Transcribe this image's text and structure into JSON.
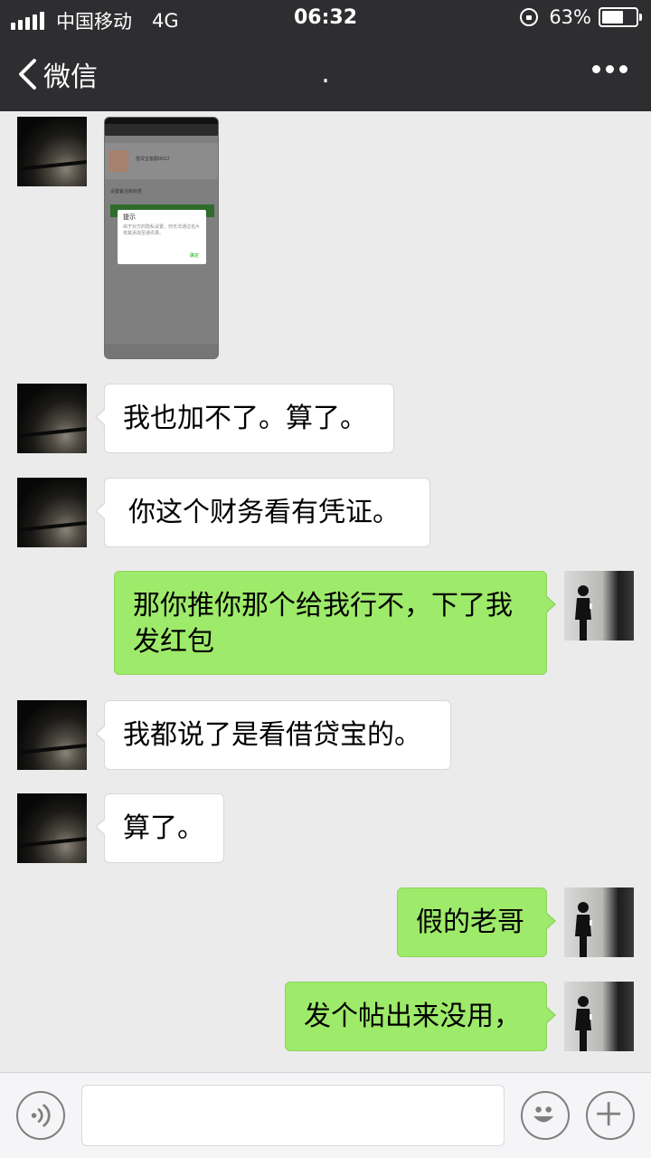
{
  "status_bar": {
    "carrier": "中国移动",
    "network": "4G",
    "time": "06:32",
    "battery": "63%",
    "battery_level": 0.63
  },
  "nav": {
    "back_label": "微信",
    "title": "."
  },
  "image_message": {
    "dialog_title": "提示",
    "dialog_body": "由于对方的隐私设置，你无法通过名片将其添加至通讯录。",
    "dialog_button": "确定",
    "profile_name": "借贷宝客服0022",
    "setting_label": "设置备注和标签"
  },
  "messages": [
    {
      "side": "in",
      "text": "我也加不了。算了。"
    },
    {
      "side": "in",
      "text": "你这个财务看有凭证。"
    },
    {
      "side": "out",
      "text": "那你推你那个给我行不，下了我发红包"
    },
    {
      "side": "in",
      "text": "我都说了是看借贷宝的。"
    },
    {
      "side": "in",
      "text": "算了。"
    },
    {
      "side": "out",
      "text": "假的老哥"
    },
    {
      "side": "out",
      "text": "发个帖出来没用，"
    }
  ],
  "input_bar": {
    "placeholder": "",
    "icons": [
      "voice-icon",
      "emoji-icon",
      "plus-icon"
    ]
  }
}
